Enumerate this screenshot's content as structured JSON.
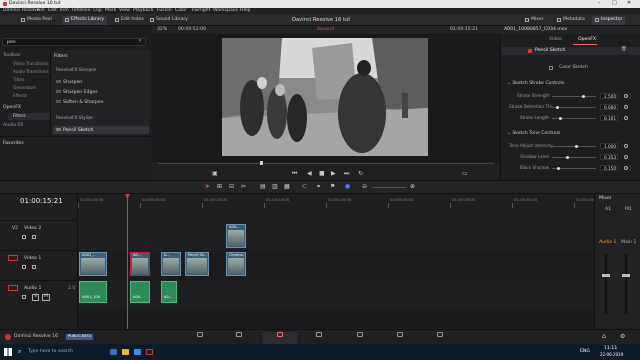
{
  "window": {
    "title": "Davinci Resolve 16 tut",
    "controls": [
      "–",
      "□",
      "✕"
    ]
  },
  "menu": [
    "DaVinci Resolve",
    "File",
    "Edit",
    "Trim",
    "Timeline",
    "Clip",
    "Mark",
    "View",
    "Playback",
    "Fusion",
    "Color",
    "Fairlight",
    "Workspace",
    "Help"
  ],
  "toolbar": {
    "media_pool": "Media Pool",
    "effects_library": "Effects Library",
    "edit_index": "Edit Index",
    "sound_library": "Sound Library",
    "project_title": "Davinci Resolve 16 tut",
    "mixer": "Mixer",
    "metadata": "Metadata",
    "inspector": "Inspector"
  },
  "search": {
    "value": "pen"
  },
  "tree": [
    "Toolbox",
    "Video Transitions",
    "Audio Transitions",
    "Titles",
    "Generators",
    "Effects",
    "OpenFX",
    "Filters",
    "Audio FX"
  ],
  "filters": {
    "header": "Filters",
    "groups": [
      {
        "name": "ResolveFX Sharpen",
        "items": [
          "Sharpen",
          "Sharpen Edges",
          "Soften & Sharpen"
        ]
      },
      {
        "name": "ResolveFX Stylize",
        "items": [
          "Pencil Sketch"
        ]
      }
    ]
  },
  "favorites": "Favorites",
  "viewer": {
    "zoom": "32%",
    "timecode_left": "00:00:52:06",
    "timeline_name": "Second",
    "timecode_right": "01:00:15:21"
  },
  "inspector": {
    "clip_name": "A001_10080857_C034.mov",
    "tabs": [
      "Video",
      "OpenFX"
    ],
    "effect": "Pencil Sketch",
    "color_sketch": "Color Sketch",
    "sections": [
      {
        "title": "Sketch Stroke Controls",
        "params": [
          {
            "label": "Stroke Strength",
            "value": "2.500",
            "fill": 0.72
          },
          {
            "label": "Stroke Detection Thr...",
            "value": "0.060",
            "fill": 0.12
          },
          {
            "label": "Stroke Length",
            "value": "0.161",
            "fill": 0.2
          }
        ]
      },
      {
        "title": "Sketch Tone Controls",
        "params": [
          {
            "label": "Tone Adjust Intensity",
            "value": "1.000",
            "fill": 0.55
          },
          {
            "label": "Shadow Level",
            "value": "0.353",
            "fill": 0.35
          },
          {
            "label": "Black Shadow",
            "value": "0.150",
            "fill": 0.15
          }
        ]
      }
    ]
  },
  "timeline": {
    "timecode": "01:00:15:21",
    "ruler": [
      "01:00:00:00",
      "01:00:05:00",
      "01:00:10:00",
      "01:00:15:00",
      "01:00:20:00",
      "01:00:25:00",
      "01:00:30:00",
      "01:00:35:00",
      "01:00:40:00"
    ],
    "tracks": [
      {
        "id": "V2",
        "name": "Video 2"
      },
      {
        "id": "V1",
        "name": "Video 1"
      },
      {
        "id": "A1",
        "name": "Audio 1",
        "level": "2.0"
      }
    ],
    "clips_v2": [
      {
        "label": "A00..."
      }
    ],
    "clips_v1": [
      {
        "label": "A001_..."
      },
      {
        "label": "A0..."
      },
      {
        "label": "A..."
      },
      {
        "label": "Pencil Sk..."
      },
      {
        "label": "Cinema..."
      }
    ],
    "clips_a1": [
      {
        "label": "A001_100"
      },
      {
        "label": "A00..."
      },
      {
        "label": "A0..."
      }
    ]
  },
  "mixer": {
    "title": "Mixer",
    "channels": [
      "A1",
      "M1"
    ],
    "buses": [
      "Audio 1",
      "Main 1"
    ]
  },
  "pages": [
    "Media",
    "Cut",
    "Edit",
    "Fusion",
    "Color",
    "Fairlight",
    "Deliver"
  ],
  "active_page": "Edit",
  "footer": {
    "app_label": "DaVinci Resolve 16",
    "badge": "PUBLIC BETA"
  },
  "taskbar": {
    "search_placeholder": "Type here to search",
    "time": "11:11",
    "date": "22-06-2019",
    "lang": "ENG"
  }
}
